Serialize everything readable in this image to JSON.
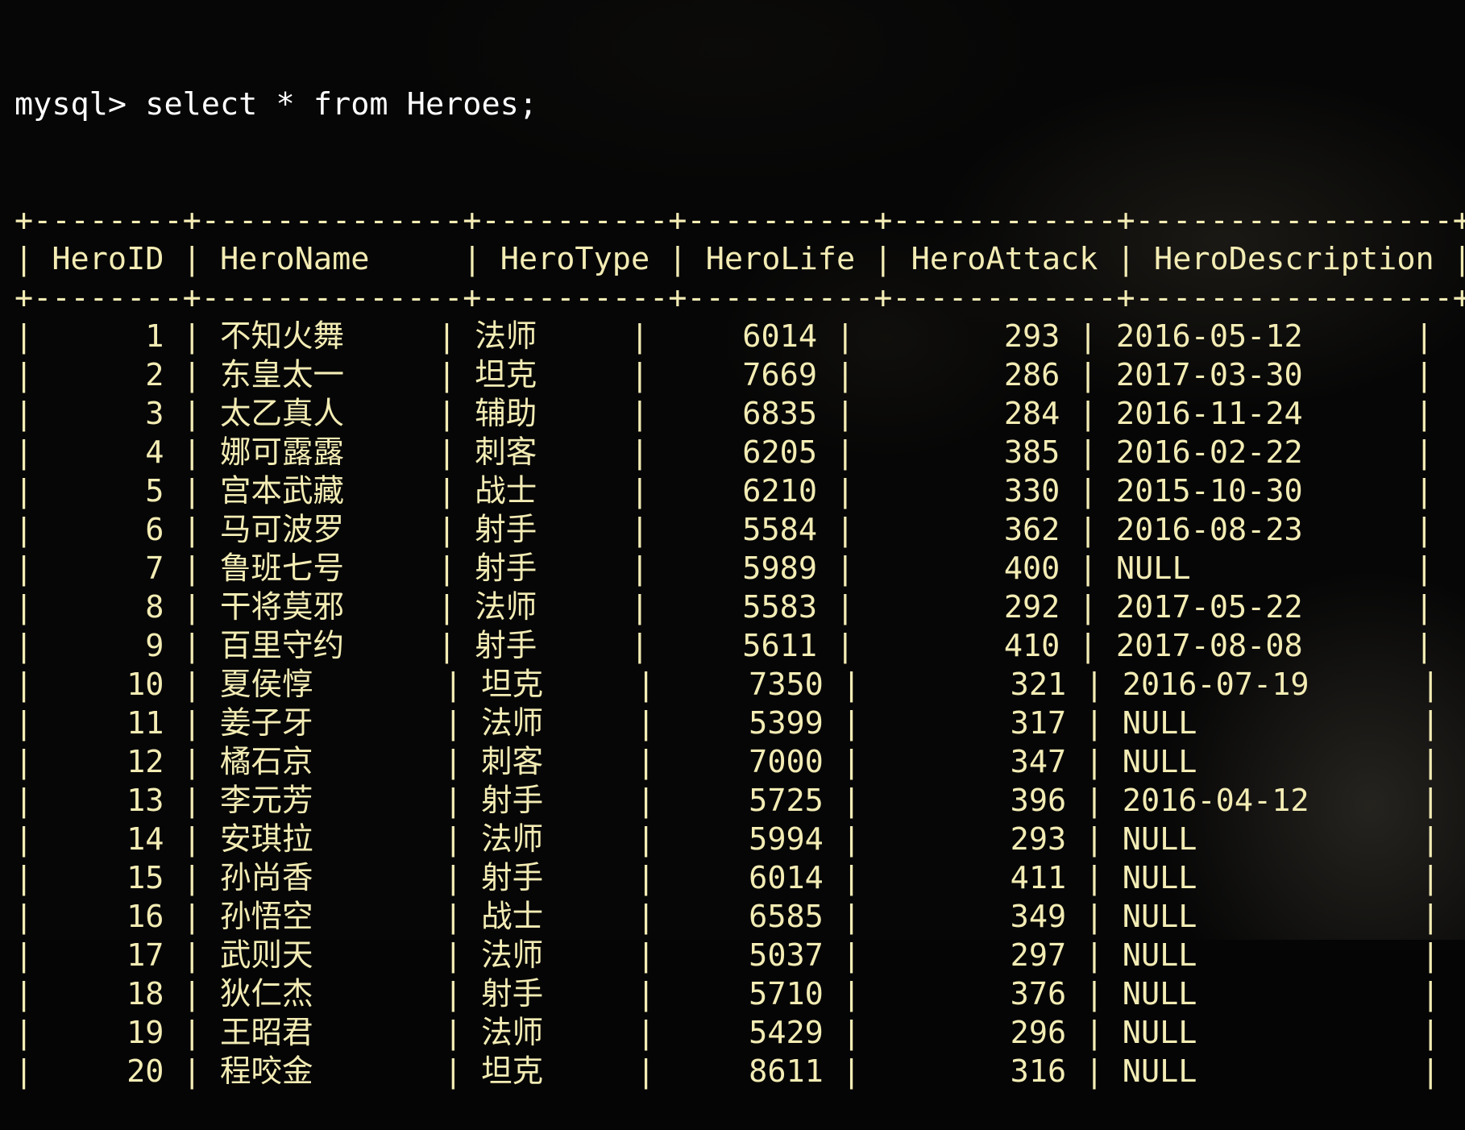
{
  "terminal": {
    "prompt": "mysql>",
    "command": "select * from Heroes;"
  },
  "table": {
    "columns": [
      "HeroID",
      "HeroName",
      "HeroType",
      "HeroLife",
      "HeroAttack",
      "HeroDescription"
    ],
    "rows": [
      [
        "1",
        "不知火舞",
        "法师",
        "6014",
        "293",
        "2016-05-12"
      ],
      [
        "2",
        "东皇太一",
        "坦克",
        "7669",
        "286",
        "2017-03-30"
      ],
      [
        "3",
        "太乙真人",
        "辅助",
        "6835",
        "284",
        "2016-11-24"
      ],
      [
        "4",
        "娜可露露",
        "刺客",
        "6205",
        "385",
        "2016-02-22"
      ],
      [
        "5",
        "宫本武藏",
        "战士",
        "6210",
        "330",
        "2015-10-30"
      ],
      [
        "6",
        "马可波罗",
        "射手",
        "5584",
        "362",
        "2016-08-23"
      ],
      [
        "7",
        "鲁班七号",
        "射手",
        "5989",
        "400",
        "NULL"
      ],
      [
        "8",
        "干将莫邪",
        "法师",
        "5583",
        "292",
        "2017-05-22"
      ],
      [
        "9",
        "百里守约",
        "射手",
        "5611",
        "410",
        "2017-08-08"
      ],
      [
        "10",
        "夏侯惇",
        "坦克",
        "7350",
        "321",
        "2016-07-19"
      ],
      [
        "11",
        "姜子牙",
        "法师",
        "5399",
        "317",
        "NULL"
      ],
      [
        "12",
        "橘石京",
        "刺客",
        "7000",
        "347",
        "NULL"
      ],
      [
        "13",
        "李元芳",
        "射手",
        "5725",
        "396",
        "2016-04-12"
      ],
      [
        "14",
        "安琪拉",
        "法师",
        "5994",
        "293",
        "NULL"
      ],
      [
        "15",
        "孙尚香",
        "射手",
        "6014",
        "411",
        "NULL"
      ],
      [
        "16",
        "孙悟空",
        "战士",
        "6585",
        "349",
        "NULL"
      ],
      [
        "17",
        "武则天",
        "法师",
        "5037",
        "297",
        "NULL"
      ],
      [
        "18",
        "狄仁杰",
        "射手",
        "5710",
        "376",
        "NULL"
      ],
      [
        "19",
        "王昭君",
        "法师",
        "5429",
        "296",
        "NULL"
      ],
      [
        "20",
        "程咬金",
        "坦克",
        "8611",
        "316",
        "NULL"
      ]
    ]
  },
  "colors": {
    "text": "#f3ecb4",
    "command": "#ffffff",
    "background": "#050505"
  }
}
